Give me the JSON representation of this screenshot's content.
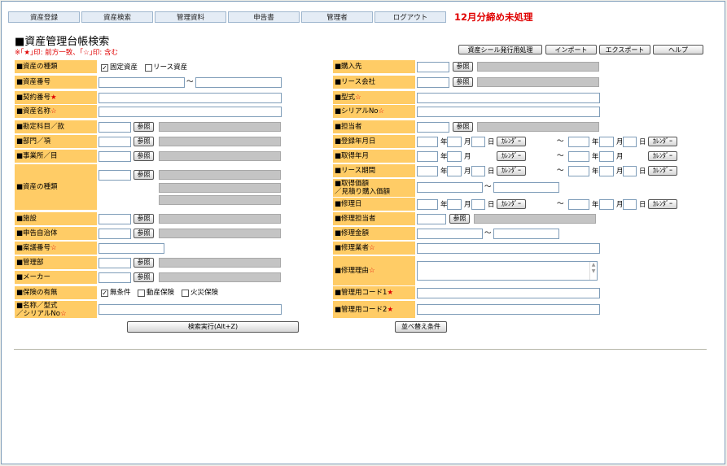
{
  "nav": {
    "items": [
      "資産登録",
      "資産検索",
      "管理資料",
      "申告書",
      "管理者",
      "ログアウト"
    ],
    "notice": "12月分締め未処理"
  },
  "page": {
    "title": "■資産管理台帳検索",
    "legend": "※｢★｣印: 前方一致、｢☆｣印: 含む"
  },
  "toolbar": {
    "seal": "資産シール発行用処理",
    "import": "インポート",
    "export": "エクスポート",
    "help": "ヘルプ"
  },
  "common": {
    "ref": "参照",
    "tilde": "～",
    "year": "年",
    "month": "月",
    "day": "日",
    "calendar": "ｶﾚﾝﾀﾞｰ",
    "star": "★",
    "hollow_star": "☆"
  },
  "left": {
    "asset_type": "■資産の種類",
    "fixed_asset": "固定資産",
    "lease_asset": "リース資産",
    "asset_no": "■資産番号",
    "contract_no": "■契約番号",
    "asset_name": "■資産名称",
    "account": "■勘定科目／款",
    "dept": "■部門／項",
    "office": "■事業所／目",
    "asset_type2": "■資産の種類",
    "facility": "■施設",
    "municipality": "■申告自治体",
    "bill_no": "■案議番号",
    "mgmt_dept": "■管理部",
    "maker": "■メーカー",
    "insurance": "■保険の有無",
    "no_condition": "無条件",
    "movable_ins": "動産保険",
    "fire_ins": "火災保険",
    "name_model_1": "■名称／型式",
    "name_model_2": "／シリアルNo"
  },
  "right": {
    "vendor": "■購入先",
    "lease_co": "■リース会社",
    "model": "■型式",
    "serial": "■シリアルNo",
    "person": "■担当者",
    "reg_date": "■登録年月日",
    "acq_month": "■取得年月",
    "lease_period": "■リース期間",
    "acq_price_1": "■取得価額",
    "acq_price_2": "／見積り購入価額",
    "repair_date": "■修理日",
    "repair_person": "■修理担当者",
    "repair_amount": "■修理金額",
    "repair_vendor": "■修理業者",
    "repair_reason": "■修理理由",
    "mgmt_code1": "■管理用コード1",
    "mgmt_code2": "■管理用コード2"
  },
  "actions": {
    "search": "検索実行(Alt+Z)",
    "sort": "並べ替え条件"
  }
}
